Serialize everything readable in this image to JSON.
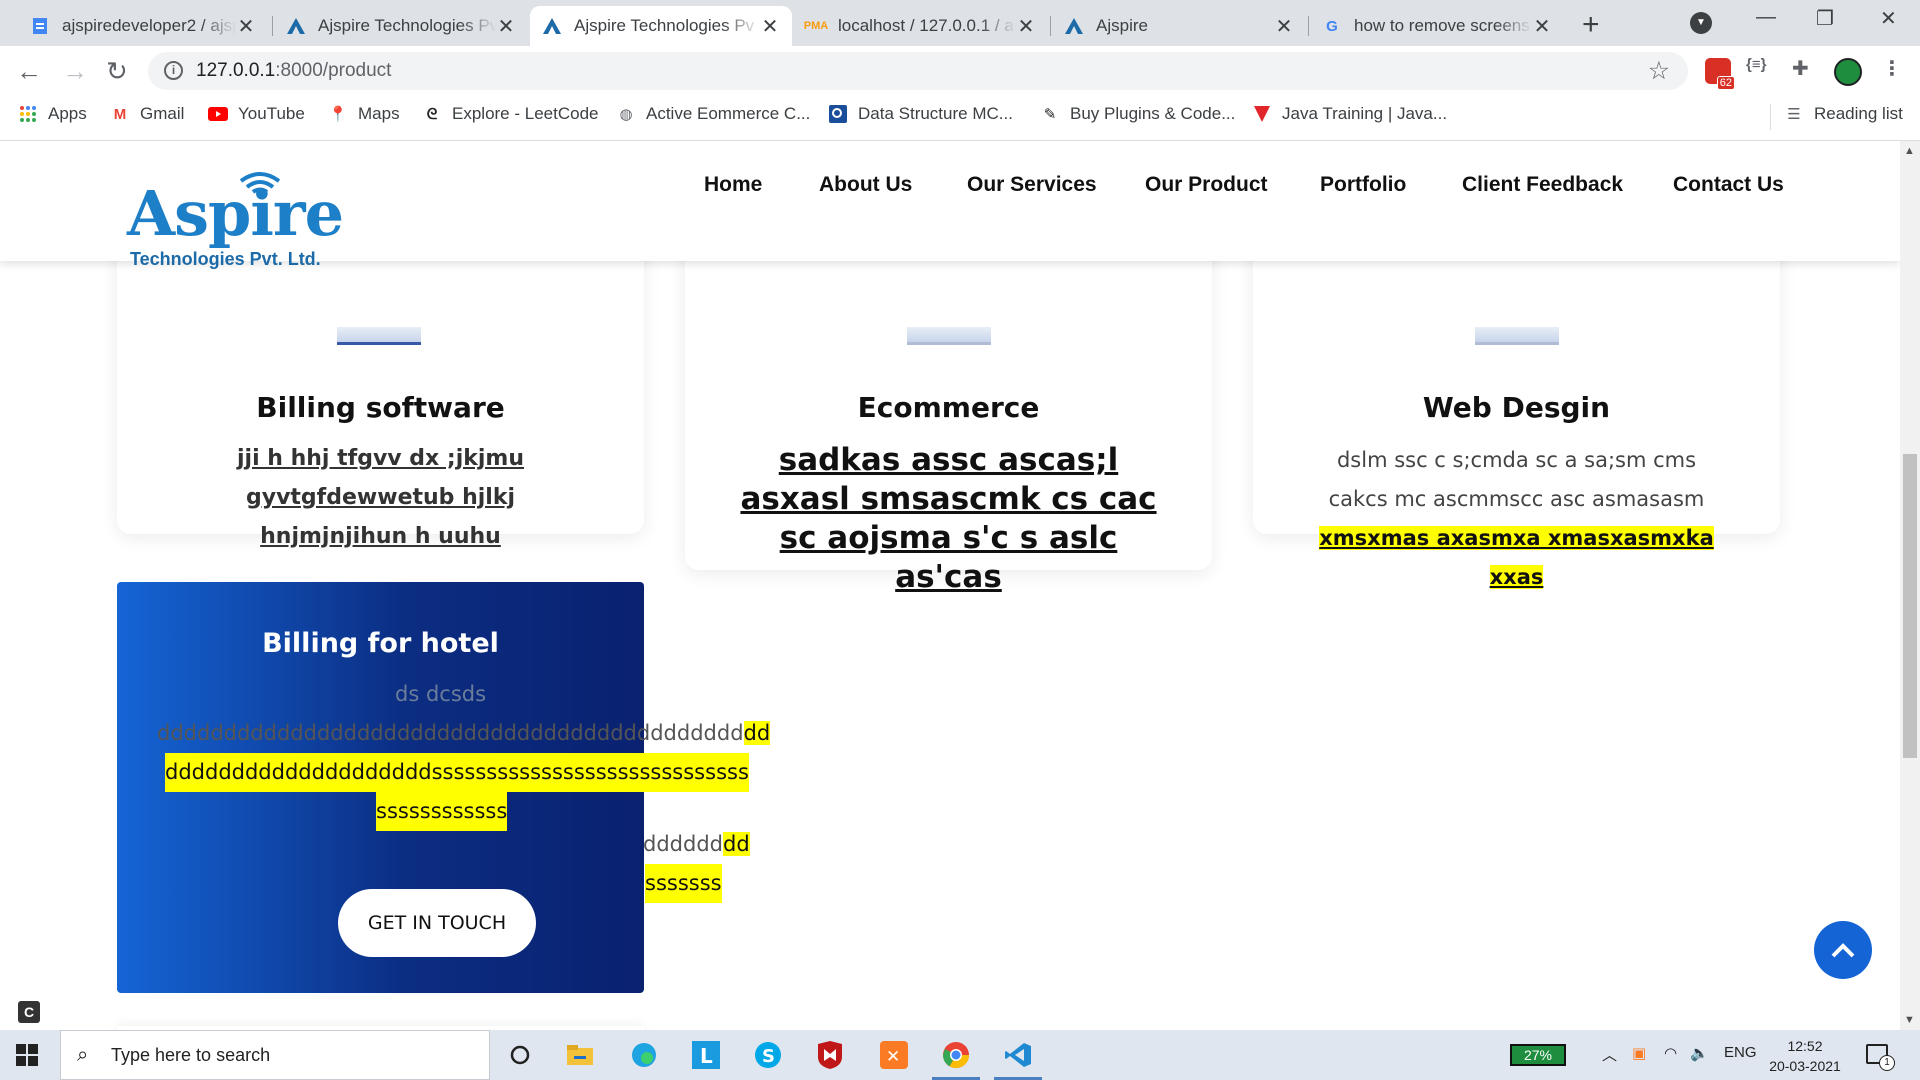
{
  "browser": {
    "tabs": [
      {
        "title": "ajspiredeveloper2 / ajsp",
        "icon": "docs-icon"
      },
      {
        "title": "Ajspire Technologies Pv",
        "icon": "aspire-icon"
      },
      {
        "title": "Ajspire Technologies Pv",
        "icon": "aspire-icon",
        "active": true
      },
      {
        "title": "localhost / 127.0.0.1 / a",
        "icon": "phpmyadmin-icon"
      },
      {
        "title": "Ajspire",
        "icon": "aspire-icon"
      },
      {
        "title": "how to remove screens",
        "icon": "google-icon"
      }
    ],
    "address": {
      "host": "127.0.0.1",
      "path": ":8000/product"
    },
    "extension_badge": "62",
    "bookmarks": [
      {
        "label": "Apps",
        "icon": "apps-grid-icon"
      },
      {
        "label": "Gmail",
        "icon": "gmail-icon"
      },
      {
        "label": "YouTube",
        "icon": "youtube-icon"
      },
      {
        "label": "Maps",
        "icon": "maps-icon"
      },
      {
        "label": "Explore - LeetCode",
        "icon": "leetcode-icon"
      },
      {
        "label": "Active Eommerce C...",
        "icon": "globe-icon"
      },
      {
        "label": "Data Structure MC...",
        "icon": "bookmark-icon"
      },
      {
        "label": "Buy Plugins & Code...",
        "icon": "codecanyon-icon"
      },
      {
        "label": "Java Training | Java...",
        "icon": "java-icon"
      }
    ],
    "reading_list": "Reading list"
  },
  "site": {
    "logo": {
      "brand": "Aspire",
      "tagline": "Technologies Pvt. Ltd."
    },
    "nav": [
      "Home",
      "About Us",
      "Our Services",
      "Our Product",
      "Portfolio",
      "Client Feedback",
      "Contact Us"
    ]
  },
  "products": [
    {
      "title": "Billing software",
      "desc": "jji h hhj tfgvv dx ;jkjmu gyvtgfdewwetub hjlkj hnjmjnjihun h uuhu"
    },
    {
      "title": "Ecommerce",
      "desc": "sadkas assc ascas;l asxasl smsascmk cs cac sc aojsma s'c s aslc as'cas"
    },
    {
      "title": "Web Desgin",
      "desc_plain": "dslm ssc c s;cmda sc a sa;sm cms cakcs mc ascmmscc asc asmasasm",
      "desc_highlight": "xmsxmas axasmxa xmasxasmxka xxas"
    },
    {
      "title": "Billing for hotel",
      "lines": [
        "ds dcsds",
        "dddddddddddddddddddddddddddddddddddddddddddd",
        "dd",
        "ddddddddddddddddddddsssssssssssssssssssssssssssss",
        "ssssssssssss",
        "dddddd",
        "dd",
        "sssssss"
      ],
      "cta": "GET IN TOUCH"
    }
  ],
  "taskbar": {
    "search_placeholder": "Type here to search",
    "battery": "27%",
    "language": "ENG",
    "time": "12:52",
    "date": "20-03-2021",
    "notifications": "1"
  },
  "colors": {
    "brand_blue": "#1d7fc7",
    "card_gradient_start": "#1565d6",
    "card_gradient_end": "#0a2170",
    "highlight": "#ffff00"
  }
}
